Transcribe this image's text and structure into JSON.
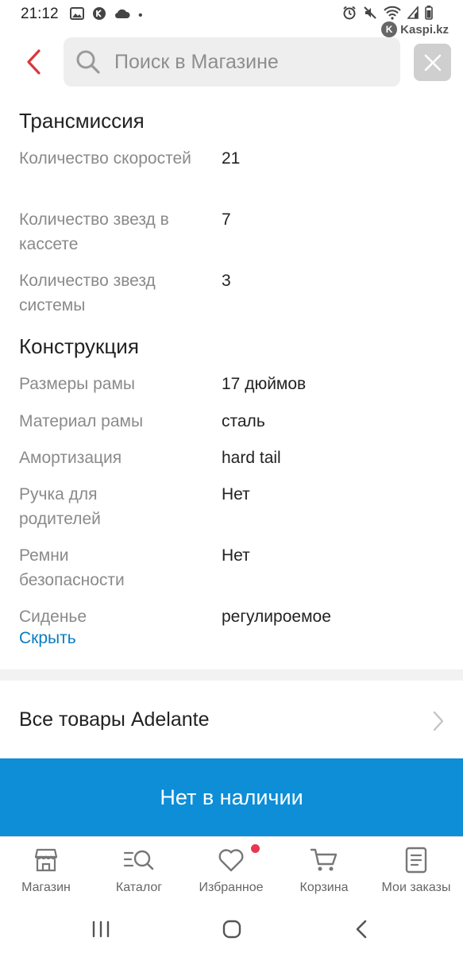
{
  "status_bar": {
    "time": "21:12",
    "dot": "•",
    "watermark": "Kaspi.kz"
  },
  "search": {
    "placeholder": "Поиск в Магазине"
  },
  "specs": {
    "transmission": {
      "title": "Трансмиссия",
      "rows": [
        {
          "label": "Количество скоростей",
          "value": "21"
        },
        {
          "label": "Количество звезд в кассете",
          "value": "7"
        },
        {
          "label": "Количество звезд системы",
          "value": "3"
        }
      ]
    },
    "construction": {
      "title": "Конструкция",
      "rows": [
        {
          "label": "Размеры рамы",
          "value": "17 дюймов"
        },
        {
          "label": "Материал рамы",
          "value": "сталь"
        },
        {
          "label": "Амортизация",
          "value": "hard tail"
        },
        {
          "label": "Ручка для родителей",
          "value": "Нет"
        },
        {
          "label": "Ремни безопасности",
          "value": "Нет"
        },
        {
          "label": "Сиденье",
          "value": "регулироемое"
        }
      ]
    },
    "hide_label": "Скрыть"
  },
  "all_products": {
    "label": "Все товары Adelante"
  },
  "cta": {
    "label": "Нет в наличии"
  },
  "bottom_nav": {
    "items": [
      {
        "label": "Магазин",
        "icon": "store-icon"
      },
      {
        "label": "Каталог",
        "icon": "catalog-search-icon"
      },
      {
        "label": "Избранное",
        "icon": "heart-icon"
      },
      {
        "label": "Корзина",
        "icon": "cart-icon"
      },
      {
        "label": "Мои заказы",
        "icon": "orders-icon"
      }
    ]
  },
  "colors": {
    "accent_blue": "#0d8ed7",
    "link_blue": "#0a7cc1",
    "back_red": "#d9363e",
    "badge_red": "#e8384f"
  }
}
